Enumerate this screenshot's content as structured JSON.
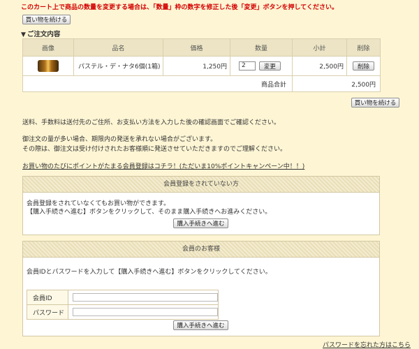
{
  "notice": "このカート上で商品の数量を変更する場合は、「数量」枠の数字を修正した後「変更」ボタンを押してください。",
  "continue_shopping_label": "買い物を続ける",
  "order_section_title": "ご注文内容",
  "cart": {
    "headers": {
      "image": "画像",
      "name": "品名",
      "price": "価格",
      "qty": "数量",
      "subtotal": "小計",
      "delete": "削除"
    },
    "item": {
      "name": "パステル・デ・ナタ6個(1箱)",
      "price": "1,250円",
      "qty": "2",
      "change_label": "変更",
      "subtotal": "2,500円",
      "delete_label": "削除"
    },
    "total_label": "商品合計",
    "total_value": "2,500円"
  },
  "info": {
    "line1": "送料、手数料は送付先のご住所、お支払い方法を入力した後の確認画面でご確認ください。",
    "line2": "御注文の量が多い場合、期限内の発送を承れない場合がございます。",
    "line3": "その際は、御注文は受け付けされたお客様順に発送させていただきますのでご理解ください。"
  },
  "promo_link": "お買い物のたびにポイントがたまる会員登録はコチラ！(ただいま10%ポイントキャンペーン中！！)",
  "guest": {
    "title": "会員登録をされていない方",
    "line1": "会員登録をされていなくてもお買い物ができます。",
    "line2": "【購入手続きへ進む】ボタンをクリックして、そのまま購入手続きへお進みください。",
    "button": "購入手続きへ進む"
  },
  "member": {
    "title": "会員のお客様",
    "line1": "会員IDとパスワードを入力して【購入手続きへ進む】ボタンをクリックしてください。",
    "id_label": "会員ID",
    "password_label": "パスワード",
    "button": "購入手続きへ進む"
  },
  "forgot_password": "パスワードを忘れた方はこちら"
}
